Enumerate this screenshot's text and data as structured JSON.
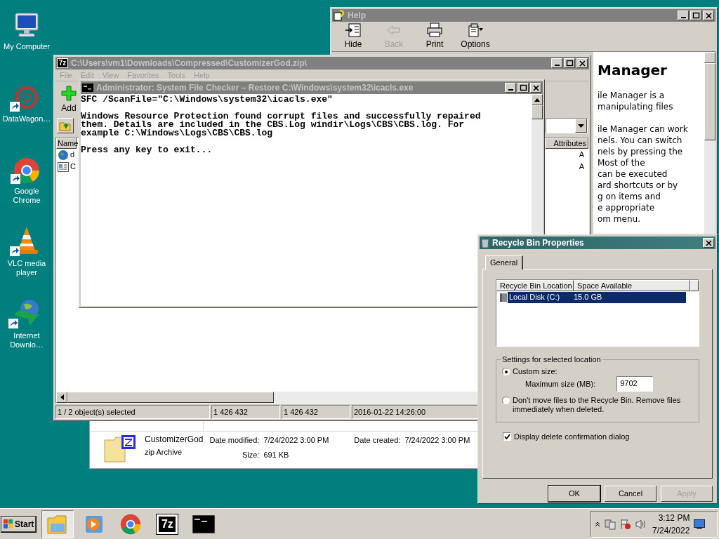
{
  "desktop_icons": [
    {
      "label": "My Computer",
      "kind": "computer",
      "shortcut": false
    },
    {
      "label": "DataWagon…",
      "kind": "dots",
      "shortcut": true
    },
    {
      "label": "Google Chrome",
      "kind": "chrome",
      "shortcut": true
    },
    {
      "label": "VLC media player",
      "kind": "cone",
      "shortcut": true
    },
    {
      "label": "Internet Downlo…",
      "kind": "globe",
      "shortcut": true
    }
  ],
  "help": {
    "title": "Help",
    "toolbar": [
      {
        "label": "Hide",
        "kind": "hide",
        "disabled": false
      },
      {
        "label": "Back",
        "kind": "back",
        "disabled": true
      },
      {
        "label": "Print",
        "kind": "print",
        "disabled": false
      },
      {
        "label": "Options",
        "kind": "options",
        "disabled": false
      }
    ],
    "heading": "Manager",
    "paragraphs": [
      [
        "ile Manager is a",
        "manipulating files"
      ],
      [
        "ile Manager can work",
        "nels. You can switch",
        "nels by pressing the",
        "Most of the",
        "can be executed",
        "ard shortcuts or by",
        "g on items and",
        "e appropriate",
        "om menu."
      ]
    ]
  },
  "archive": {
    "icon_label": "7z",
    "title": "C:\\Users\\vm1\\Downloads\\Compressed\\CustomizerGod.zip\\",
    "menu": [
      "File",
      "Edit",
      "View",
      "Favorites",
      "Tools",
      "Help"
    ],
    "toolbar": [
      {
        "label": "Add"
      }
    ],
    "columns": [
      "Name",
      "Attributes"
    ],
    "rows": [
      {
        "name": "d",
        "kind": "web",
        "attributes": "A"
      },
      {
        "name": "C",
        "kind": "document",
        "attributes": "A"
      }
    ],
    "status": [
      "1 / 2 object(s) selected",
      "1 426 432",
      "1 426 432",
      "2016-01-22 14:26:00"
    ]
  },
  "console": {
    "title": "Administrator:  System File Checker – Restore C:\\Windows\\system32\\icacls.exe",
    "blocks": [
      [
        "SFC /ScanFile=\"C:\\Windows\\system32\\icacls.exe\""
      ],
      [
        "Windows Resource Protection found corrupt files and successfully repaired",
        "them. Details are included in the CBS.Log windir\\Logs\\CBS\\CBS.log. For",
        "example C:\\Windows\\Logs\\CBS\\CBS.log"
      ],
      [
        "Press any key to exit..."
      ]
    ]
  },
  "details": {
    "name": "CustomizerGod",
    "type": "zip Archive",
    "fields": [
      {
        "label": "Date modified:",
        "value": "7/24/2022 3:00 PM"
      },
      {
        "label": "Size:",
        "value": "691 KB"
      },
      {
        "label": "Date created:",
        "value": "7/24/2022 3:00 PM"
      }
    ]
  },
  "recycle": {
    "title": "Recycle Bin Properties",
    "tabs": [
      {
        "label": "General",
        "selected": true
      }
    ],
    "columns": [
      "Recycle Bin Location",
      "Space Available"
    ],
    "locations": [
      {
        "name": "Local Disk (C:)",
        "space": "15.0 GB",
        "selected": true
      }
    ],
    "group_title": "Settings for selected location",
    "options": [
      {
        "label": "Custom size:",
        "selected": true
      },
      {
        "label": "Don't move files to the Recycle Bin. Remove files immediately when deleted.",
        "selected": false
      }
    ],
    "max_size_label": "Maximum size (MB):",
    "max_size": "9702",
    "confirm": {
      "label": "Display delete confirmation dialog",
      "checked": true
    },
    "buttons": [
      {
        "label": "OK",
        "disabled": false
      },
      {
        "label": "Cancel",
        "disabled": false
      },
      {
        "label": "Apply",
        "disabled": true
      }
    ]
  },
  "taskbar": {
    "start": "Start",
    "apps": [
      {
        "kind": "explorer",
        "selected": true
      },
      {
        "kind": "media",
        "selected": false
      },
      {
        "kind": "chrome",
        "selected": false
      },
      {
        "kind": "archiver",
        "label": "7z",
        "selected": false
      },
      {
        "kind": "console",
        "selected": false
      }
    ],
    "time": "3:12 PM",
    "date": "7/24/2022"
  }
}
